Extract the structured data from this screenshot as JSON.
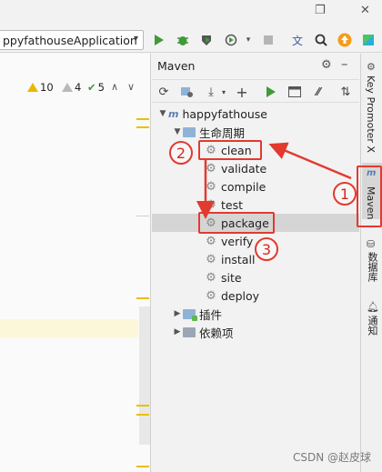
{
  "toolbar": {
    "run_config": "ppyfathouseApplication",
    "caret": "▾",
    "restore": "❐",
    "close": "✕",
    "icons": [
      "run-icon",
      "debug-icon",
      "coverage-icon",
      "profile-icon",
      "stop-icon",
      "translate-icon",
      "search-icon",
      "update-icon",
      "toolbox-icon"
    ]
  },
  "editor": {
    "inspections": {
      "warnings": "10",
      "weak_warnings": "4",
      "ok": "5",
      "up": "∧",
      "down": "∨"
    }
  },
  "maven": {
    "title": "Maven",
    "tree": {
      "project": "happyfathouse",
      "lifecycle": "生命周期",
      "phases": [
        "clean",
        "validate",
        "compile",
        "test",
        "package",
        "verify",
        "install",
        "site",
        "deploy"
      ],
      "selected": "package",
      "plugins": "插件",
      "dependencies": "依赖项"
    }
  },
  "side_tabs": [
    "Key Promoter X",
    "Maven",
    "数据库",
    "通知"
  ],
  "annotations": {
    "one": "1",
    "two": "2",
    "three": "3"
  },
  "watermark": "CSDN @赵皮球",
  "colors": {
    "annotation": "#e23a2f",
    "selection": "#d5d5d5",
    "run_green": "#3f9a3a"
  }
}
